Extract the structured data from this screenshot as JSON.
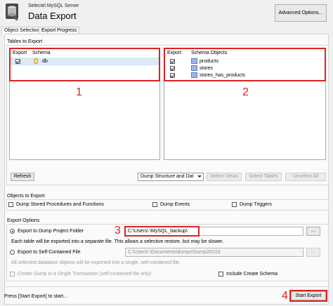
{
  "header": {
    "subtitle": "Selectel MySQL Server",
    "title": "Data Export",
    "advanced_button": "Advanced Options..."
  },
  "tabs": [
    {
      "label": "Object Selection",
      "active": true
    },
    {
      "label": "Export Progress",
      "active": false
    }
  ],
  "tables_section": {
    "label": "Tables to Export",
    "left_list": {
      "columns": [
        "Export",
        "Schema"
      ],
      "rows": [
        {
          "checked": true,
          "name": "db"
        }
      ]
    },
    "right_list": {
      "columns": [
        "Export",
        "Schema Objects"
      ],
      "rows": [
        {
          "checked": true,
          "name": "products"
        },
        {
          "checked": true,
          "name": "stores"
        },
        {
          "checked": true,
          "name": "stores_has_products"
        }
      ]
    },
    "refresh_button": "Refresh",
    "dump_select": "Dump Structure and Dat",
    "select_views_button": "Select Views",
    "select_tables_button": "Select Tables",
    "unselect_all_button": "Unselect All"
  },
  "objects_section": {
    "label": "Objects to Export",
    "options": [
      {
        "label": "Dump Stored Procedures and Functions",
        "checked": false
      },
      {
        "label": "Dump Events",
        "checked": false
      },
      {
        "label": "Dump Triggers",
        "checked": false
      }
    ]
  },
  "export_options": {
    "label": "Export Options",
    "project_folder": {
      "label": "Export to Dump Project Folder",
      "selected": true,
      "path": "C:\\Users\\        \\MySQL_backup\\",
      "browse": "..."
    },
    "project_note": "Each table will be exported into a separate file. This allows a selective restore, but may be slower.",
    "self_contained": {
      "label": "Export to Self-Contained File",
      "selected": false,
      "path": "C:\\Users\\        \\Documents\\dumps\\Dump20210",
      "browse": "..."
    },
    "self_note": "All selected database objects will be exported into a single, self-contained file.",
    "single_transaction": "Create Dump in a Single Transaction (self-contained file only)",
    "include_schema": "Include Create Schema"
  },
  "footer": {
    "status": "Press [Start Export] to start...",
    "start_button": "Start Export"
  },
  "annotations": [
    "1",
    "2",
    "3",
    "4"
  ],
  "colors": {
    "annotation": "#dd2222",
    "selection": "#dbe9f8"
  }
}
